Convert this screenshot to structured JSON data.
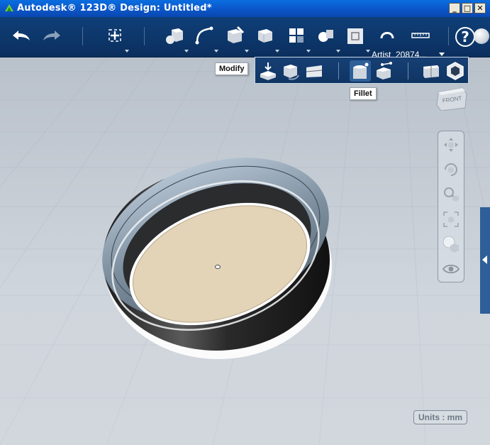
{
  "window": {
    "title": "Autodesk® 123D® Design: Untitled*",
    "controls": [
      "_",
      "□",
      "✕"
    ]
  },
  "toolbar": {
    "items": [
      {
        "icon": "undo-icon"
      },
      {
        "icon": "redo-icon"
      },
      {
        "icon": "transform-icon"
      },
      {
        "icon": "primitives-icon"
      },
      {
        "icon": "sketch-icon"
      },
      {
        "icon": "construct-icon"
      },
      {
        "icon": "modify-icon"
      },
      {
        "icon": "pattern-icon"
      },
      {
        "icon": "grouping-icon"
      },
      {
        "icon": "combine-icon"
      },
      {
        "icon": "snap-icon"
      },
      {
        "icon": "measure-icon"
      }
    ],
    "account_label": "Artist_20874..."
  },
  "tooltips": {
    "modify": "Modify",
    "fillet": "Fillet"
  },
  "flyout": {
    "items": [
      {
        "icon": "press-pull-icon"
      },
      {
        "icon": "tweak-icon"
      },
      {
        "icon": "split-face-icon"
      },
      {
        "icon": "fillet-icon",
        "active": true
      },
      {
        "icon": "chamfer-icon"
      },
      {
        "icon": "split-solid-icon"
      },
      {
        "icon": "shell-icon"
      }
    ]
  },
  "viewcube": {
    "face_label": "FRONT"
  },
  "navbar": {
    "items": [
      {
        "icon": "pan-icon"
      },
      {
        "icon": "orbit-icon"
      },
      {
        "icon": "zoom-icon"
      },
      {
        "icon": "fit-icon"
      },
      {
        "icon": "materials-icon"
      },
      {
        "icon": "visibility-icon"
      }
    ]
  },
  "status": {
    "units": "Units : mm"
  },
  "colors": {
    "toolbar": "#0f3f78",
    "titlebar": "#0b56c9",
    "ring_metal": "#7f95a8",
    "ring_face": "#e3d4b8",
    "viewport": "#c9d0d8"
  }
}
